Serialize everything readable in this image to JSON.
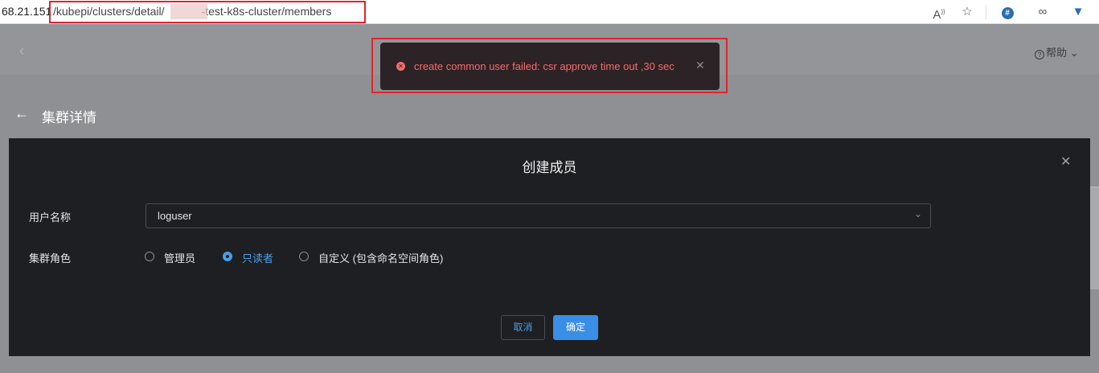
{
  "browser": {
    "url_host": "68.21.151",
    "url_path_start": "/kubepi/clusters/detail/",
    "url_path_end": "-test-k8s-cluster/members",
    "icons": [
      "read-aloud-icon",
      "add-favorite-icon",
      "extension-hash-icon",
      "infinity-icon",
      "extension-shield-icon"
    ]
  },
  "header": {
    "help_label": "帮助",
    "help_glyph": "?"
  },
  "page": {
    "title": "集群详情"
  },
  "toast": {
    "message": "create common user failed: csr approve time out ,30 sec",
    "close_glyph": "✕",
    "color": "#f56c6c"
  },
  "dialog": {
    "title": "创建成员",
    "username_label": "用户名称",
    "username_value": "loguser",
    "role_label": "集群角色",
    "roles": [
      {
        "label": "管理员",
        "checked": false
      },
      {
        "label": "只读者",
        "checked": true
      },
      {
        "label": "自定义 (包含命名空间角色)",
        "checked": false
      }
    ],
    "cancel_label": "取消",
    "confirm_label": "确定"
  },
  "colors": {
    "accent": "#3a8ee6",
    "dialog_bg": "#1e1f23",
    "highlight": "#e0242c"
  }
}
